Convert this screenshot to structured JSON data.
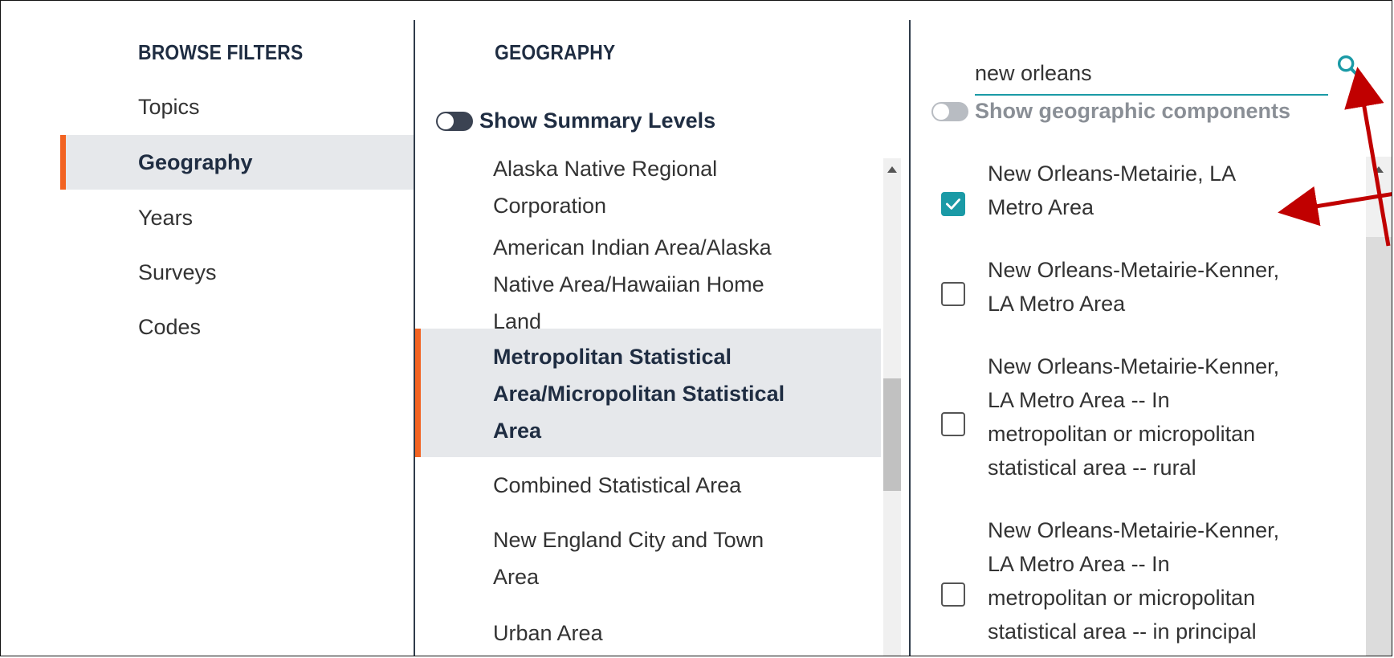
{
  "left": {
    "heading": "BROWSE FILTERS",
    "items": [
      {
        "label": "Topics"
      },
      {
        "label": "Geography",
        "active": true
      },
      {
        "label": "Years"
      },
      {
        "label": "Surveys"
      },
      {
        "label": "Codes"
      }
    ]
  },
  "middle": {
    "heading": "GEOGRAPHY",
    "toggle_label": "Show Summary Levels",
    "items": [
      {
        "label": "Alaska Native Regional\nCorporation"
      },
      {
        "label": "American Indian Area/Alaska\nNative Area/Hawaiian Home\nLand"
      },
      {
        "label": "Metropolitan Statistical\nArea/Micropolitan Statistical\nArea",
        "active": true
      },
      {
        "label": "Combined Statistical Area"
      },
      {
        "label": "New England City and Town\nArea"
      },
      {
        "label": "Urban Area"
      }
    ]
  },
  "right": {
    "search_value": "new orleans",
    "toggle_label": "Show geographic components",
    "results": [
      {
        "label": "New Orleans-Metairie, LA\nMetro Area",
        "checked": true
      },
      {
        "label": "New Orleans-Metairie-Kenner,\nLA Metro Area",
        "checked": false
      },
      {
        "label": "New Orleans-Metairie-Kenner,\nLA Metro Area -- In\nmetropolitan or micropolitan\nstatistical area -- rural",
        "checked": false
      },
      {
        "label": "New Orleans-Metairie-Kenner,\nLA Metro Area -- In\nmetropolitan or micropolitan\nstatistical area -- in principal\ncity",
        "checked": false
      }
    ]
  },
  "colors": {
    "accent": "#f26322",
    "teal": "#1a9aa6",
    "arrow": "#c00000"
  },
  "icons": {
    "search": "search-icon",
    "check": "check-icon"
  }
}
